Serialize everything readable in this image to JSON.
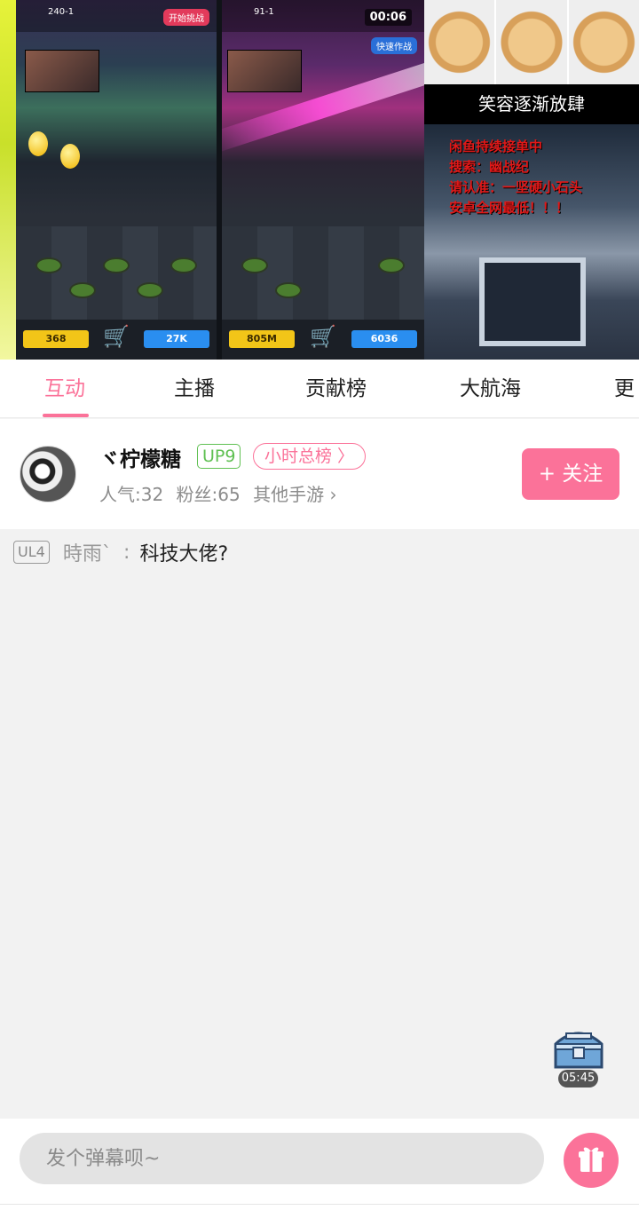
{
  "video": {
    "game1": {
      "stage": "240-1",
      "gold": "368",
      "blue": "27K",
      "tag": "开始挑战"
    },
    "game2": {
      "stage": "91-1",
      "gold": "805M",
      "blue": "6036",
      "timer": "00:06",
      "tag": "快速作战"
    },
    "meme_caption": "笑容逐渐放肆",
    "ad_lines": [
      "闲鱼持续接单中",
      "搜索：幽战纪",
      "请认准：一坚硬小石头",
      "安卓全网最低！！！"
    ]
  },
  "tabs": [
    {
      "label": "互动",
      "active": true
    },
    {
      "label": "主播",
      "active": false
    },
    {
      "label": "贡献榜",
      "active": false
    },
    {
      "label": "大航海",
      "active": false
    },
    {
      "label": "更",
      "active": false
    }
  ],
  "streamer": {
    "name": "ヾ柠檬糖",
    "level_badge": "UP9",
    "rank_badge": "小时总榜 〉",
    "popularity": "人气:32",
    "fans": "粉丝:65",
    "category": "其他手游 ›",
    "follow_label": "+ 关注"
  },
  "chat": [
    {
      "badge": "UL4",
      "user": "時雨ˋ",
      "separator": ":",
      "text": "科技大佬?"
    }
  ],
  "chest_timer": "05:45",
  "input": {
    "placeholder": "发个弹幕呗~"
  },
  "colors": {
    "accent": "#fb7299",
    "up_badge": "#5fc052"
  }
}
